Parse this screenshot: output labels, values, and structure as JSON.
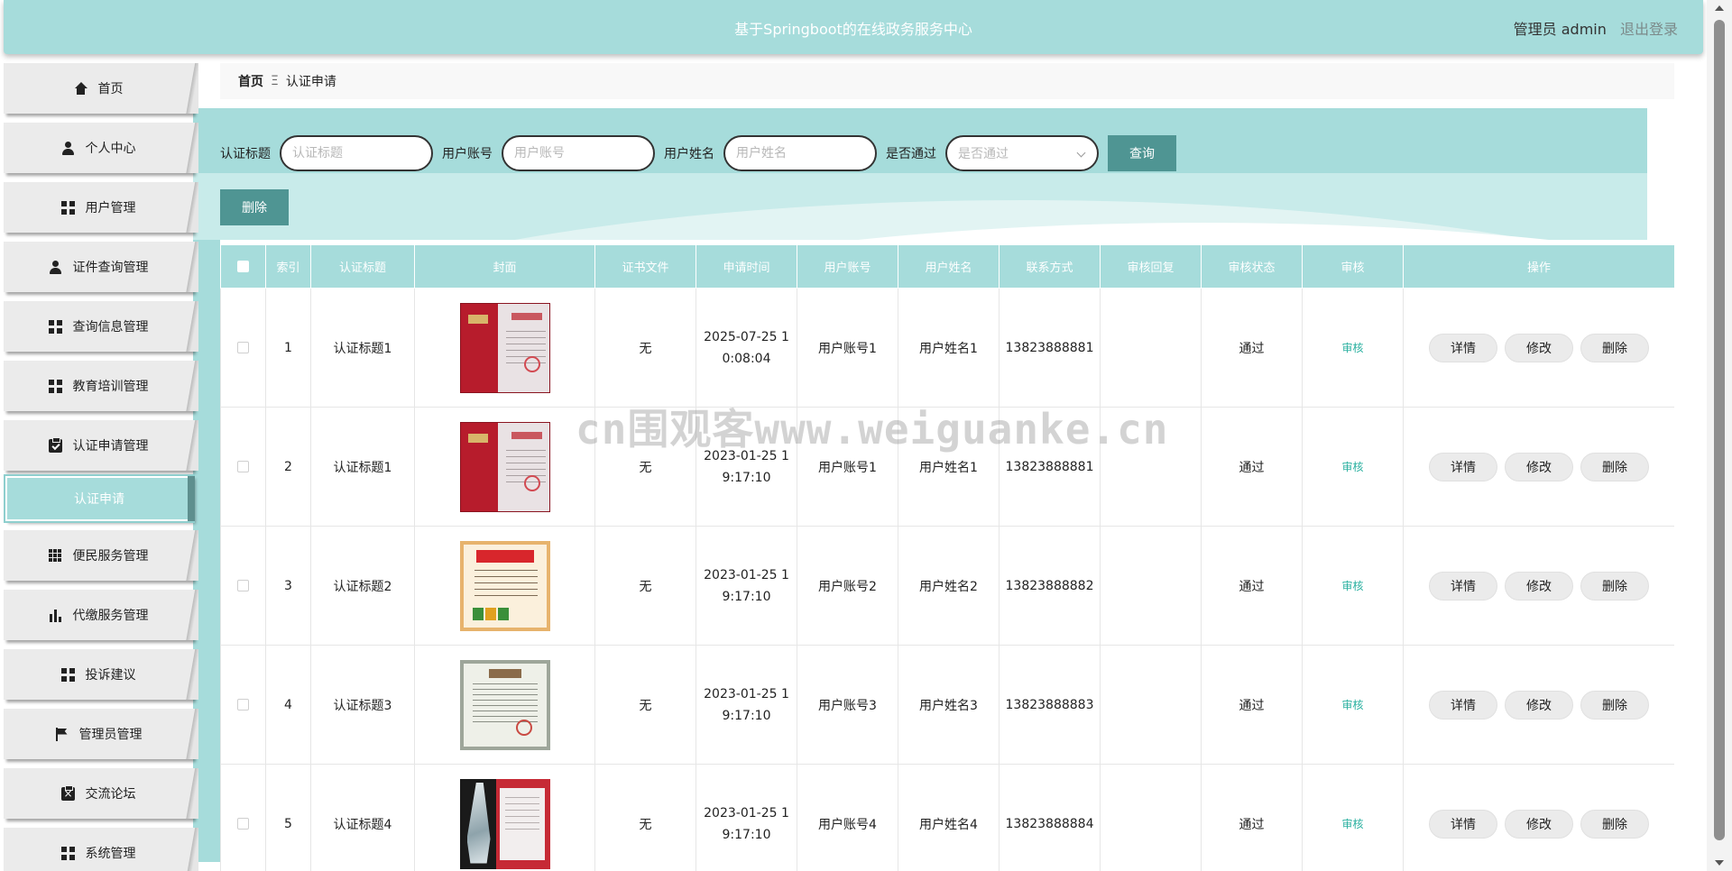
{
  "header": {
    "title": "基于Springboot的在线政务服务中心",
    "user_label": "管理员 admin",
    "logout_label": "退出登录",
    "bg_color": "#a6dcdb"
  },
  "sidebar": {
    "items": [
      {
        "label": "首页",
        "icon": "home-icon"
      },
      {
        "label": "个人中心",
        "icon": "user-icon"
      },
      {
        "label": "用户管理",
        "icon": "grid-icon"
      },
      {
        "label": "证件查询管理",
        "icon": "user-icon"
      },
      {
        "label": "查询信息管理",
        "icon": "grid-icon"
      },
      {
        "label": "教育培训管理",
        "icon": "grid-icon"
      },
      {
        "label": "认证申请管理",
        "icon": "clipboard-check-icon"
      },
      {
        "label": "便民服务管理",
        "icon": "grid-nine-icon"
      },
      {
        "label": "代缴服务管理",
        "icon": "bar-chart-icon"
      },
      {
        "label": "投诉建议",
        "icon": "grid-icon"
      },
      {
        "label": "管理员管理",
        "icon": "flag-icon"
      },
      {
        "label": "交流论坛",
        "icon": "clipboard-x-icon"
      },
      {
        "label": "系统管理",
        "icon": "grid-icon"
      }
    ],
    "active_sub": "认证申请"
  },
  "breadcrumb": {
    "home": "首页",
    "separator": "Ξ",
    "current": "认证申请"
  },
  "search": {
    "title_label": "认证标题",
    "title_placeholder": "认证标题",
    "account_label": "用户账号",
    "account_placeholder": "用户账号",
    "name_label": "用户姓名",
    "name_placeholder": "用户姓名",
    "passed_label": "是否通过",
    "passed_placeholder": "是否通过",
    "query_button": "查询"
  },
  "toolbar": {
    "delete_button": "删除"
  },
  "table": {
    "columns": [
      "索引",
      "认证标题",
      "封面",
      "证书文件",
      "申请时间",
      "用户账号",
      "用户姓名",
      "联系方式",
      "审核回复",
      "审核状态",
      "审核",
      "操作"
    ],
    "rows": [
      {
        "index": "1",
        "title": "认证标题1",
        "cover": "red-certificate",
        "file": "无",
        "time": "2025-07-25 10:08:04",
        "account": "用户账号1",
        "name": "用户姓名1",
        "phone": "13823888881",
        "reply": "",
        "status": "通过",
        "audit": "审核"
      },
      {
        "index": "2",
        "title": "认证标题1",
        "cover": "red-certificate",
        "file": "无",
        "time": "2023-01-25 19:17:10",
        "account": "用户账号1",
        "name": "用户姓名1",
        "phone": "13823888881",
        "reply": "",
        "status": "通过",
        "audit": "审核"
      },
      {
        "index": "3",
        "title": "认证标题2",
        "cover": "honor-certificate",
        "file": "无",
        "time": "2023-01-25 19:17:10",
        "account": "用户账号2",
        "name": "用户姓名2",
        "phone": "13823888882",
        "reply": "",
        "status": "通过",
        "audit": "审核"
      },
      {
        "index": "4",
        "title": "认证标题3",
        "cover": "donation-certificate",
        "file": "无",
        "time": "2023-01-25 19:17:10",
        "account": "用户账号3",
        "name": "用户姓名3",
        "phone": "13823888883",
        "reply": "",
        "status": "通过",
        "audit": "审核"
      },
      {
        "index": "5",
        "title": "认证标题4",
        "cover": "trophy-certificate",
        "file": "无",
        "time": "2023-01-25 19:17:10",
        "account": "用户账号4",
        "name": "用户姓名4",
        "phone": "13823888884",
        "reply": "",
        "status": "通过",
        "audit": "审核"
      }
    ],
    "actions": {
      "detail": "详情",
      "edit": "修改",
      "delete": "删除"
    }
  },
  "watermark": "cn围观客www.weiguanke.cn"
}
